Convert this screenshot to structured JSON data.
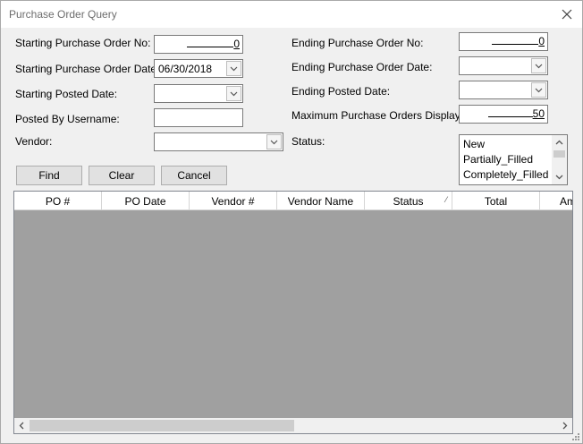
{
  "window": {
    "title": "Purchase Order Query"
  },
  "form": {
    "start_po_label": "Starting Purchase Order No:",
    "start_po_value": "0",
    "start_date_label": "Starting Purchase Order Date:",
    "start_date_value": "06/30/2018",
    "start_posted_label": "Starting Posted Date:",
    "start_posted_value": "",
    "posted_by_label": "Posted By Username:",
    "posted_by_value": "",
    "vendor_label": "Vendor:",
    "vendor_value": "",
    "end_po_label": "Ending Purchase Order No:",
    "end_po_value": "0",
    "end_date_label": "Ending Purchase Order Date:",
    "end_date_value": "",
    "end_posted_label": "Ending Posted Date:",
    "end_posted_value": "",
    "max_po_label": "Maximum Purchase Orders Displayed:",
    "max_po_value": "50",
    "status_label": "Status:",
    "status_options": [
      "New",
      "Partially_Filled",
      "Completely_Filled"
    ]
  },
  "buttons": {
    "find": "Find",
    "clear": "Clear",
    "cancel": "Cancel"
  },
  "grid": {
    "columns": [
      "PO #",
      "PO Date",
      "Vendor #",
      "Vendor Name",
      "Status",
      "Total",
      "Am"
    ],
    "rows": []
  },
  "icons": {
    "close": "close-icon",
    "dropdown": "chevron-down-icon",
    "scroll_up": "chevron-up-icon",
    "scroll_down": "chevron-down-icon",
    "scroll_left": "chevron-left-icon",
    "scroll_right": "chevron-right-icon"
  },
  "colors": {
    "grid_background": "#a0a0a0",
    "window_background": "#f0f0f0",
    "button_face": "#e1e1e1"
  }
}
